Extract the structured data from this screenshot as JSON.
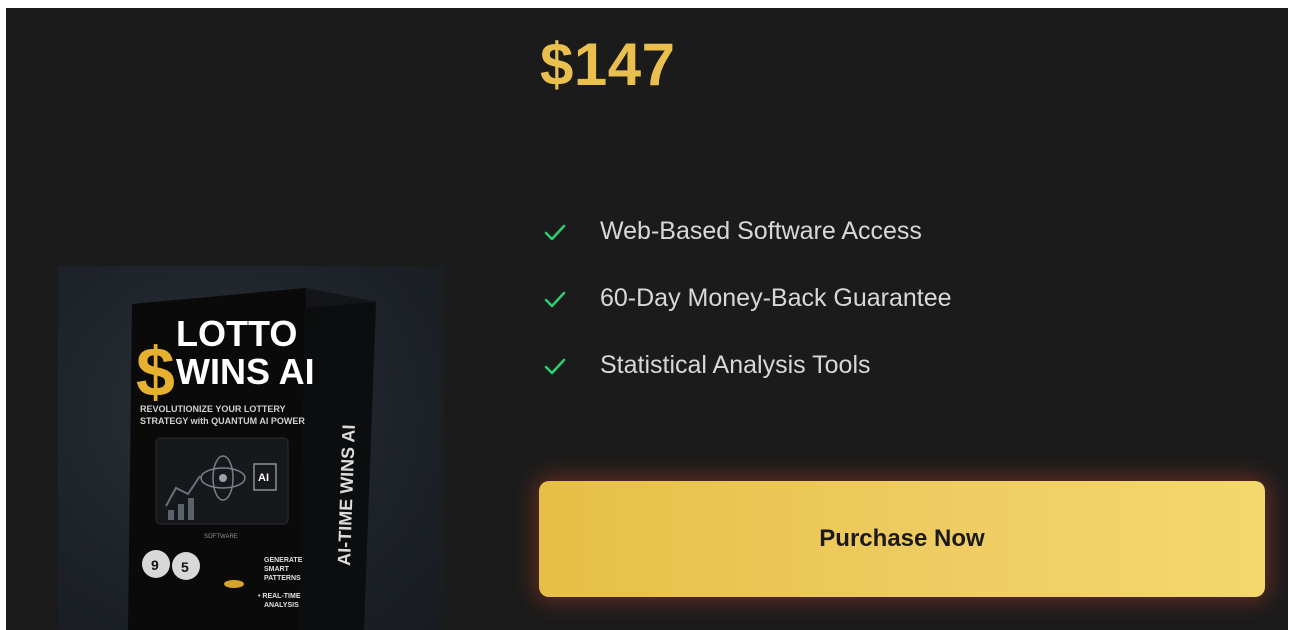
{
  "offer": {
    "price": "$147",
    "cta_label": "Purchase Now"
  },
  "features": [
    {
      "label": "Web-Based Software Access"
    },
    {
      "label": "60-Day Money-Back Guarantee"
    },
    {
      "label": "Statistical Analysis Tools"
    }
  ],
  "product_box": {
    "title_line1": "LOTTO",
    "title_line2": "WINS AI",
    "dollar_glyph": "$",
    "tagline_line1": "REVOLUTIONIZE YOUR LOTTERY",
    "tagline_line2": "STRATEGY with QUANTUM AI POWER",
    "ai_badge": "AI",
    "software_label": "SOFTWARE",
    "ball_1": "9",
    "ball_2": "5",
    "bullet_1_line1": "GENERATE",
    "bullet_1_line2": "SMART",
    "bullet_1_line3": "PATTERNS",
    "bullet_2_line1": "• REAL-TIME",
    "bullet_2_line2": "ANALYSIS",
    "spine_text": "AI-TIME WINS AI"
  },
  "colors": {
    "background": "#1b1b1b",
    "price": "#e9bf4e",
    "check": "#2ecc71",
    "button": "#efcc62"
  },
  "icons": {
    "check": "check-icon"
  }
}
